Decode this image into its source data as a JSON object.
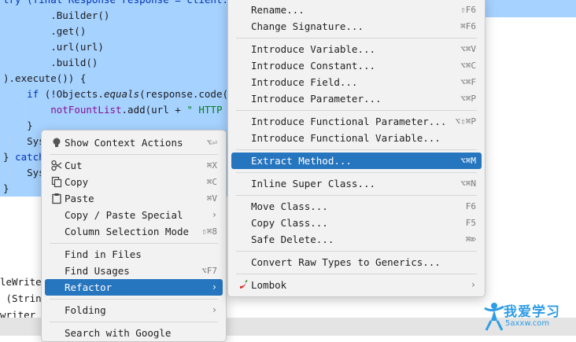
{
  "editor": {
    "lines": [
      {
        "parts": [
          {
            "t": "try (final Response response = client.ne",
            "c": "kw"
          }
        ]
      },
      {
        "parts": [
          {
            "t": "        .Builder()"
          }
        ]
      },
      {
        "parts": [
          {
            "t": "        .get()"
          }
        ]
      },
      {
        "parts": [
          {
            "t": "        .url(url)"
          }
        ]
      },
      {
        "parts": [
          {
            "t": "        .build()"
          }
        ]
      },
      {
        "parts": [
          {
            "t": ").execute()) {"
          }
        ]
      },
      {
        "parts": [
          {
            "t": "    "
          },
          {
            "t": "if",
            "c": "kw"
          },
          {
            "t": " (!Objects."
          },
          {
            "t": "equals",
            "c": "it"
          },
          {
            "t": "(response.code(),"
          }
        ]
      },
      {
        "parts": [
          {
            "t": "        "
          },
          {
            "t": "notFountList",
            "c": "field"
          },
          {
            "t": ".add(url + "
          },
          {
            "t": "\" HTTP Co",
            "c": "str"
          }
        ]
      },
      {
        "parts": [
          {
            "t": "    }"
          }
        ]
      },
      {
        "parts": [
          {
            "t": "    Sys"
          }
        ]
      },
      {
        "parts": [
          {
            "t": "} "
          },
          {
            "t": "catch",
            "c": "kw"
          }
        ]
      },
      {
        "parts": [
          {
            "t": "    Sys"
          }
        ]
      },
      {
        "parts": [
          {
            "t": "}"
          }
        ]
      }
    ],
    "lower_lines": [
      "leWriter",
      " (String",
      "writer"
    ]
  },
  "context_menu": {
    "items": [
      {
        "type": "item",
        "name": "show-context-actions",
        "icon": "lightbulb-icon",
        "label": "Show Context Actions",
        "shortcut": "⌥⏎"
      },
      {
        "type": "sep"
      },
      {
        "type": "item",
        "name": "cut",
        "icon": "scissors-icon",
        "label": "Cut",
        "shortcut": "⌘X"
      },
      {
        "type": "item",
        "name": "copy",
        "icon": "copy-icon",
        "label": "Copy",
        "shortcut": "⌘C"
      },
      {
        "type": "item",
        "name": "paste",
        "icon": "clipboard-icon",
        "label": "Paste",
        "shortcut": "⌘V"
      },
      {
        "type": "item",
        "name": "copy-paste-special",
        "label": "Copy / Paste Special",
        "submenu": true
      },
      {
        "type": "item",
        "name": "column-selection-mode",
        "label": "Column Selection Mode",
        "shortcut": "⇧⌘8"
      },
      {
        "type": "sep"
      },
      {
        "type": "item",
        "name": "find-in-files",
        "label": "Find in Files"
      },
      {
        "type": "item",
        "name": "find-usages",
        "label": "Find Usages",
        "shortcut": "⌥F7"
      },
      {
        "type": "item",
        "name": "refactor",
        "label": "Refactor",
        "submenu": true,
        "active": true
      },
      {
        "type": "sep"
      },
      {
        "type": "item",
        "name": "folding",
        "label": "Folding",
        "submenu": true
      },
      {
        "type": "sep"
      },
      {
        "type": "item",
        "name": "search-with-google",
        "label": "Search with Google"
      }
    ]
  },
  "refactor_menu": {
    "items": [
      {
        "type": "item",
        "name": "rename",
        "label": "Rename...",
        "shortcut": "⇧F6"
      },
      {
        "type": "item",
        "name": "change-signature",
        "label": "Change Signature...",
        "shortcut": "⌘F6"
      },
      {
        "type": "sep"
      },
      {
        "type": "item",
        "name": "introduce-variable",
        "label": "Introduce Variable...",
        "shortcut": "⌥⌘V"
      },
      {
        "type": "item",
        "name": "introduce-constant",
        "label": "Introduce Constant...",
        "shortcut": "⌥⌘C"
      },
      {
        "type": "item",
        "name": "introduce-field",
        "label": "Introduce Field...",
        "shortcut": "⌥⌘F"
      },
      {
        "type": "item",
        "name": "introduce-parameter",
        "label": "Introduce Parameter...",
        "shortcut": "⌥⌘P"
      },
      {
        "type": "sep"
      },
      {
        "type": "item",
        "name": "introduce-functional-parameter",
        "label": "Introduce Functional Parameter...",
        "shortcut": "⌥⇧⌘P"
      },
      {
        "type": "item",
        "name": "introduce-functional-variable",
        "label": "Introduce Functional Variable..."
      },
      {
        "type": "sep"
      },
      {
        "type": "item",
        "name": "extract-method",
        "label": "Extract Method...",
        "shortcut": "⌥⌘M",
        "active": true
      },
      {
        "type": "sep"
      },
      {
        "type": "item",
        "name": "inline-super-class",
        "label": "Inline Super Class...",
        "shortcut": "⌥⌘N"
      },
      {
        "type": "sep"
      },
      {
        "type": "item",
        "name": "move-class",
        "label": "Move Class...",
        "shortcut": "F6"
      },
      {
        "type": "item",
        "name": "copy-class",
        "label": "Copy Class...",
        "shortcut": "F5"
      },
      {
        "type": "item",
        "name": "safe-delete",
        "label": "Safe Delete...",
        "shortcut": "⌘⌦"
      },
      {
        "type": "sep"
      },
      {
        "type": "item",
        "name": "convert-raw-types-to-generics",
        "label": "Convert Raw Types to Generics..."
      },
      {
        "type": "sep"
      },
      {
        "type": "item",
        "name": "lombok",
        "icon": "chili-pepper-icon",
        "label": "Lombok",
        "submenu": true
      }
    ]
  },
  "watermark": {
    "title": "我爱学习",
    "url": "5axxw.com"
  },
  "colors": {
    "selection": "#a6d2ff",
    "menu_highlight": "#2675bf",
    "menu_bg": "#f2f2f2"
  }
}
